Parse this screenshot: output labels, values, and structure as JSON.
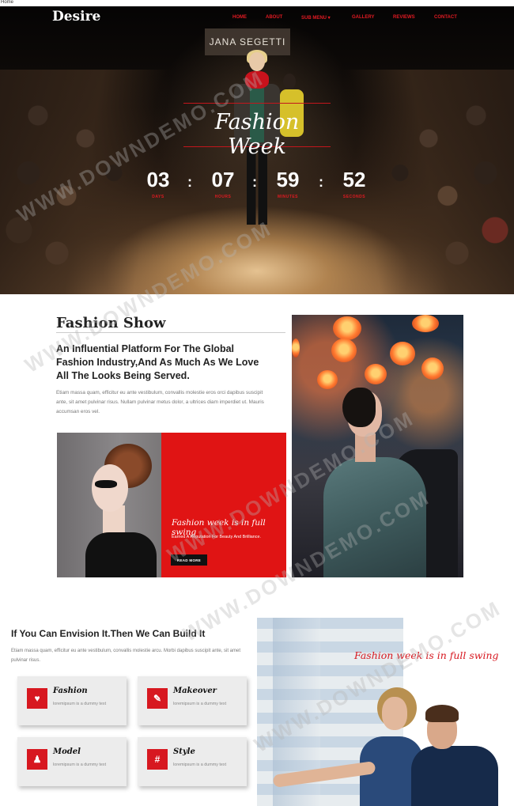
{
  "browser": {
    "title": "Home"
  },
  "nav": {
    "logo": "Desire",
    "items": [
      "HOME",
      "ABOUT",
      "SUB MENU ▾",
      "GALLERY",
      "REVIEWS",
      "CONTACT"
    ]
  },
  "hero": {
    "sign": "JANA SEGETTI",
    "title": "Fashion Week",
    "countdown": [
      {
        "value": "03",
        "label": "DAYS"
      },
      {
        "value": "07",
        "label": "HOURS"
      },
      {
        "value": "59",
        "label": "MINUTES"
      },
      {
        "value": "52",
        "label": "SECONDS"
      }
    ],
    "separator": ":"
  },
  "about": {
    "title": "Fashion Show",
    "lead": "An Influential Platform For The Global Fashion Industry,And As Much As We Love All The Looks Being Served.",
    "paragraph": "Etiam massa quam, efficitur eu ante vestibulum, convallis molestie eros orci dapibus suscipit ante, sit amet pulvinar risus. Nullam pulvinar metus dolor, a ultrices diam imperdiet ut. Mauris accumsan eros vel.",
    "card": {
      "title": "Fashion week is in full swing",
      "subtitle": "Earned A Reputation For Beauty And Brilliance.",
      "button": "READ MORE"
    }
  },
  "features": {
    "title": "If You Can Envision It.Then We Can Build It",
    "paragraph": "Etiam massa quam, efficitur eu ante vestibulum, convallis molestie arcu. Morbi dapibus suscipit ante, sit amet pulvinar risus.",
    "items": [
      {
        "name": "Fashion",
        "desc": "loremipsum is a dummy text",
        "icon": "heart-icon",
        "glyph": "♥"
      },
      {
        "name": "Makeover",
        "desc": "loremipsum is a dummy text",
        "icon": "brush-icon",
        "glyph": "✎"
      },
      {
        "name": "Model",
        "desc": "loremipsum is a dummy text",
        "icon": "person-icon",
        "glyph": "♟"
      },
      {
        "name": "Style",
        "desc": "loremipsum is a dummy text",
        "icon": "hashtag-icon",
        "glyph": "#"
      }
    ],
    "side_title": "Fashion week is in full swing"
  },
  "watermark": "WWW.DOWNDEMO.COM",
  "colors": {
    "accent": "#e01414",
    "dark": "#111111"
  }
}
